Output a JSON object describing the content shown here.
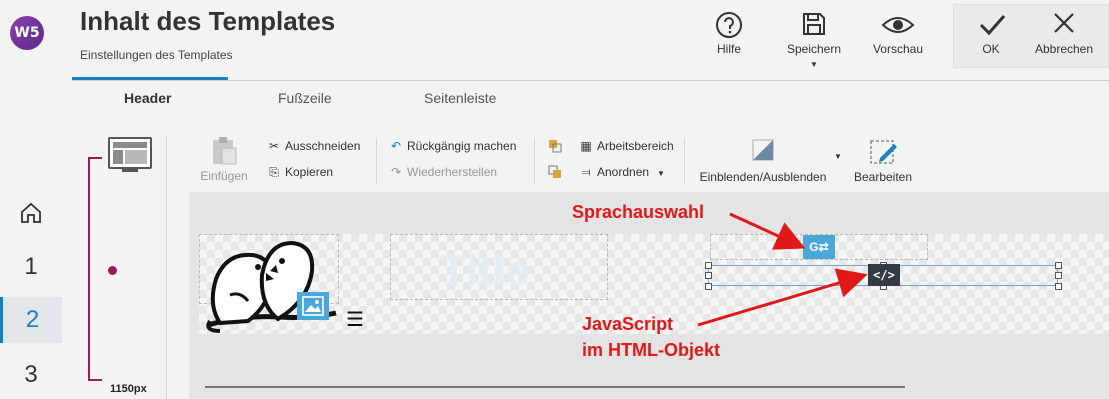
{
  "app": {
    "logo_text": "W5"
  },
  "header": {
    "title": "Inhalt des Templates",
    "subtitle": "Einstellungen des Templates",
    "buttons": {
      "help": "Hilfe",
      "save": "Speichern",
      "preview": "Vorschau",
      "ok": "OK",
      "cancel": "Abbrechen"
    }
  },
  "steps": [
    "1",
    "2",
    "3"
  ],
  "tabs": [
    {
      "label": "Header",
      "active": true
    },
    {
      "label": "Fußzeile",
      "active": false
    },
    {
      "label": "Seitenleiste",
      "active": false
    }
  ],
  "toolbar": {
    "paste": "Einfügen",
    "cut": "Ausschneiden",
    "copy": "Kopieren",
    "undo": "Rückgängig machen",
    "redo": "Wiederherstellen",
    "workspace": "Arbeitsbereich",
    "arrange": "Anordnen",
    "show_hide": "Einblenden/Ausblenden",
    "edit": "Bearbeiten"
  },
  "canvas": {
    "title_placeholder": "Title",
    "width_label": "1150px"
  },
  "annotations": {
    "language": "Sprachauswahl",
    "javascript_line1": "JavaScript",
    "javascript_line2": "im HTML-Objekt"
  },
  "colors": {
    "accent": "#1b7fc4",
    "bracket": "#9b1c55",
    "annotation": "#e01818",
    "object_icon": "#4aa8d8"
  }
}
